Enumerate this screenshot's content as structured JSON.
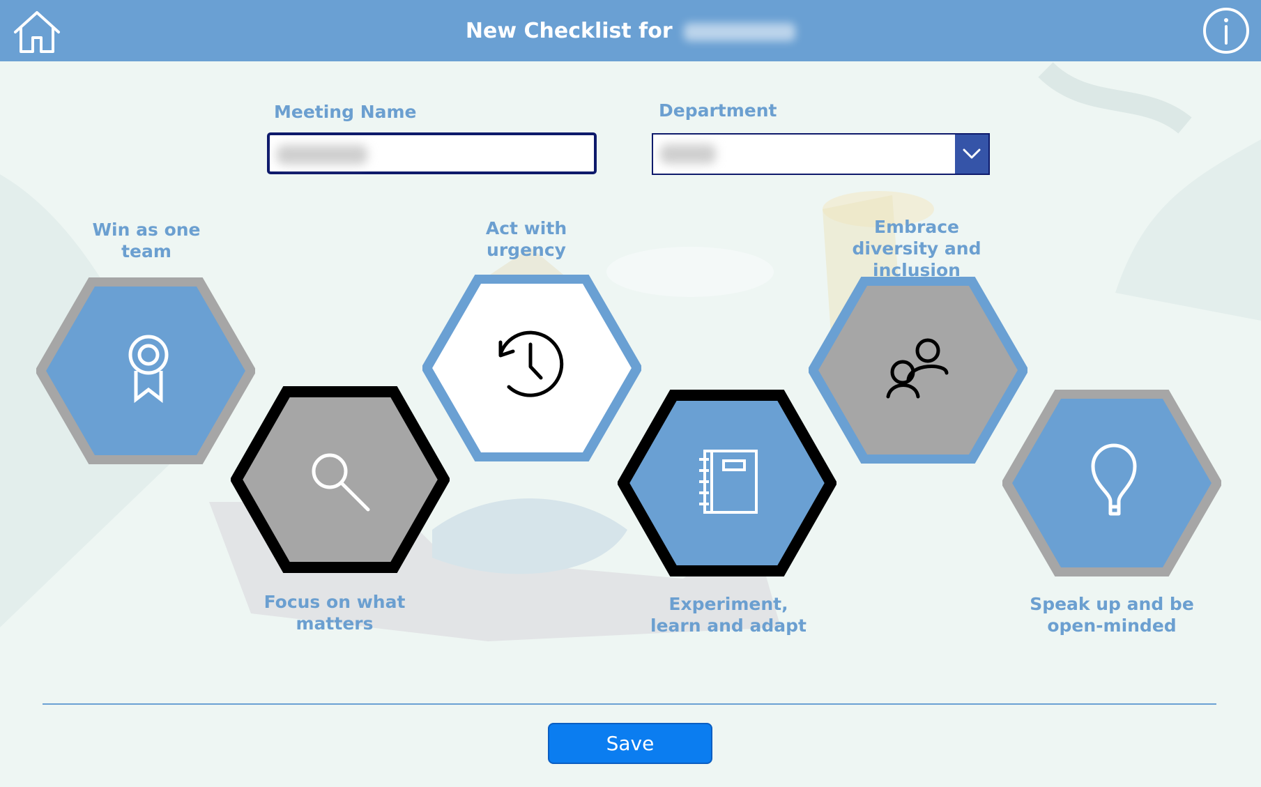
{
  "header": {
    "title": "New Checklist for",
    "home_icon": "home-icon",
    "info_icon": "info-icon",
    "color": "#6aa0d3"
  },
  "form": {
    "meeting_name_label": "Meeting Name",
    "department_label": "Department"
  },
  "values": [
    {
      "label": "Win as one team",
      "icon": "ribbon-award-icon"
    },
    {
      "label": "Focus on what matters",
      "icon": "search-icon"
    },
    {
      "label": "Act with urgency",
      "icon": "history-clock-icon"
    },
    {
      "label": "Experiment, learn and adapt",
      "icon": "notebook-icon"
    },
    {
      "label": "Embrace diversity and inclusion",
      "icon": "people-icon"
    },
    {
      "label": "Speak up and be open-minded",
      "icon": "lightbulb-icon"
    }
  ],
  "footer": {
    "save_label": "Save",
    "save_color": "#0b7df0"
  },
  "colors": {
    "accent": "#6aa0d3",
    "gray": "#a6a6a6",
    "border_dark": "#0e1a6b"
  }
}
